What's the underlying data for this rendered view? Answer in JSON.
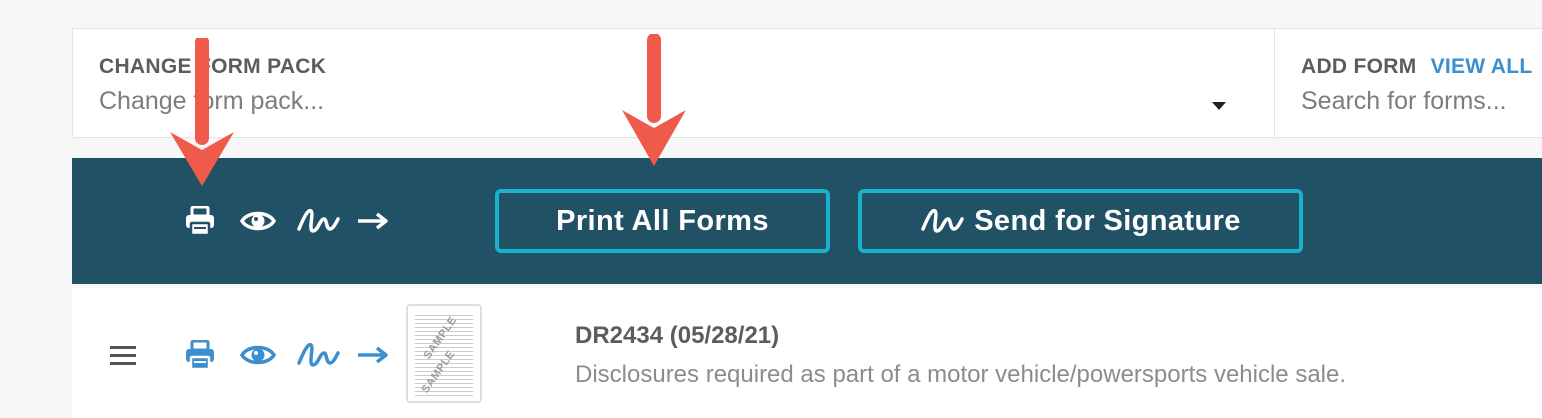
{
  "form_pack": {
    "label": "CHANGE FORM PACK",
    "placeholder": "Change form pack..."
  },
  "add_form": {
    "label": "ADD FORM",
    "view_all_label": "VIEW ALL",
    "placeholder": "Search for forms..."
  },
  "toolbar": {
    "icons": [
      "printer-icon",
      "eye-icon",
      "signature-icon",
      "arrow-right-icon"
    ],
    "print_all_label": "Print All Forms",
    "send_signature_label": "Send for Signature"
  },
  "forms": [
    {
      "title": "DR2434 (05/28/21)",
      "description": "Disclosures required as part of a motor vehicle/powersports vehicle sale.",
      "thumbnail_stamp": "SAMPLE"
    }
  ],
  "colors": {
    "toolbar_bg": "#215164",
    "button_border": "#1ab1cc",
    "icon_blue": "#3b8fd0",
    "annotation_arrow": "#f05a4a"
  }
}
